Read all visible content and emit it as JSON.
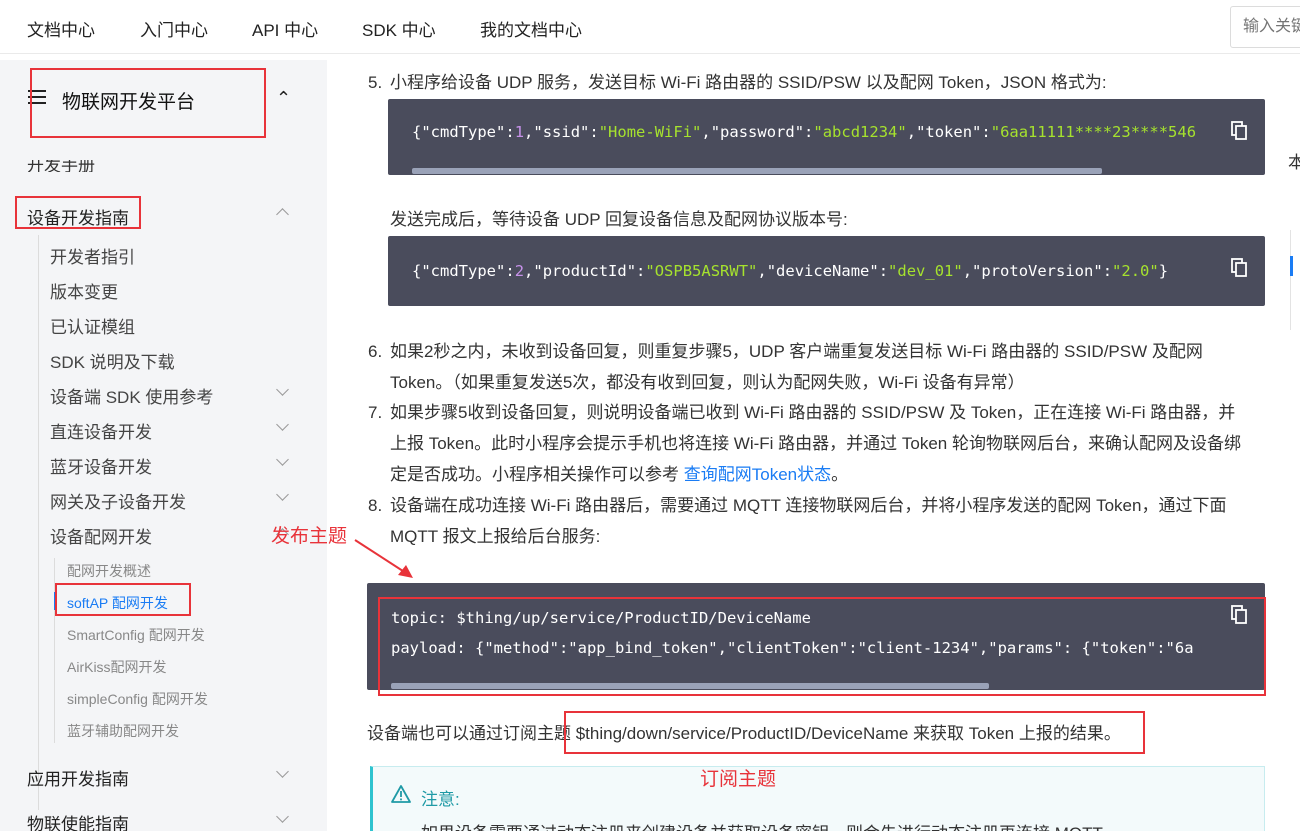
{
  "topnav": {
    "items": [
      "文档中心",
      "入门中心",
      "API 中心",
      "SDK 中心",
      "我的文档中心"
    ],
    "search_placeholder": "输入关键"
  },
  "sidebar": {
    "title": "物联网开发平台",
    "cut_item": "开发手册",
    "section_device": "设备开发指南",
    "sub_items": [
      "开发者指引",
      "版本变更",
      "已认证模组",
      "SDK 说明及下载",
      "设备端 SDK 使用参考",
      "直连设备开发",
      "蓝牙设备开发",
      "网关及子设备开发",
      "设备配网开发"
    ],
    "leaf_items": [
      "配网开发概述",
      "softAP 配网开发",
      "SmartConfig 配网开发",
      "AirKiss配网开发",
      "simpleConfig 配网开发",
      "蓝牙辅助配网开发"
    ],
    "bottom_items": [
      "应用开发指南",
      "物联使能指南"
    ]
  },
  "content": {
    "step5": "小程序给设备 UDP 服务，发送目标 Wi-Fi 路由器的 SSID/PSW 以及配网 Token，JSON 格式为:",
    "code1": {
      "k_cmdType": "\"cmdType\"",
      "v_cmdType": "1",
      "k_ssid": "\"ssid\"",
      "v_ssid": "\"Home-WiFi\"",
      "k_password": "\"password\"",
      "v_password": "\"abcd1234\"",
      "k_token": "\"token\"",
      "v_token": "\"6aa11111****23****546"
    },
    "after_send": "发送完成后，等待设备 UDP 回复设备信息及配网协议版本号:",
    "code2": {
      "k_cmdType": "\"cmdType\"",
      "v_cmdType": "2",
      "k_productId": "\"productId\"",
      "v_productId": "\"OSPB5ASRWT\"",
      "k_deviceName": "\"deviceName\"",
      "v_deviceName": "\"dev_01\"",
      "k_protoVersion": "\"protoVersion\"",
      "v_protoVersion": "\"2.0\""
    },
    "step6_line1": "如果2秒之内，未收到设备回复，则重复步骤5，UDP 客户端重复发送目标 Wi-Fi 路由器的 SSID/PSW 及配网",
    "step6_line2": "Token。（如果重复发送5次，都没有收到回复，则认为配网失败，Wi-Fi 设备有异常）",
    "step7_line1": "如果步骤5收到设备回复，则说明设备端已收到 Wi-Fi 路由器的 SSID/PSW 及 Token，正在连接 Wi-Fi 路由器，并",
    "step7_line2": "上报 Token。此时小程序会提示手机也将连接 Wi-Fi 路由器，并通过 Token 轮询物联网后台，来确认配网及设备绑",
    "step7_line3_pre": "定是否成功。小程序相关操作可以参考 ",
    "step7_link": "查询配网Token状态",
    "step7_line3_post": "。",
    "step8_line1": "设备端在成功连接 Wi-Fi 路由器后，需要通过 MQTT 连接物联网后台，并将小程序发送的配网 Token，通过下面",
    "step8_line2": "MQTT 报文上报给后台服务:",
    "code3": {
      "line1": "topic: $thing/up/service/ProductID/DeviceName",
      "line2": "payload: {\"method\":\"app_bind_token\",\"clientToken\":\"client-1234\",\"params\": {\"token\":\"6a"
    },
    "subscribe_text": "设备端也可以通过订阅主题 $thing/down/service/ProductID/DeviceName 来获取 Token 上报的结果。",
    "note_title": "注意:",
    "note_body": "如果设备需要通过动态注册来创建设备并获取设备密钥，则会先进行动态注册再连接 MQTT。",
    "right_cut": "本"
  },
  "annotations": {
    "publish": "发布主题",
    "subscribe": "订阅主题"
  },
  "colors": {
    "link": "#1a7cf4",
    "annotation": "#e8333a",
    "code_bg": "#4a4c5c",
    "code_string": "#a6e22e",
    "code_number": "#c792ea"
  }
}
